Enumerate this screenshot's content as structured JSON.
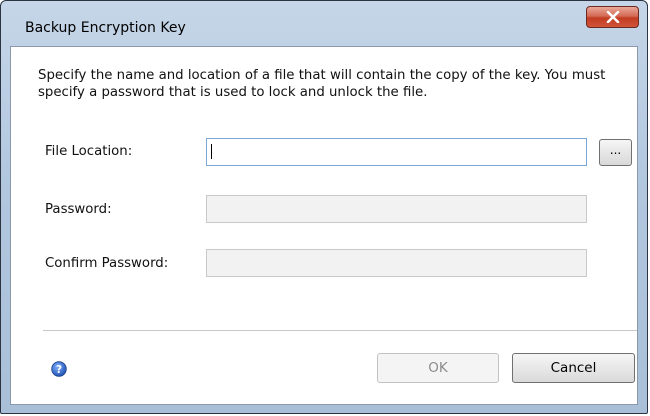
{
  "window": {
    "title": "Backup Encryption Key"
  },
  "description": "Specify the name and location of a file that will contain the copy of the key.  You must specify a password that is used to lock and unlock the file.",
  "form": {
    "file_location": {
      "label": "File Location:",
      "value": ""
    },
    "password": {
      "label": "Password:",
      "value": ""
    },
    "confirm_password": {
      "label": "Confirm Password:",
      "value": ""
    },
    "browse_label": "..."
  },
  "buttons": {
    "ok_label": "OK",
    "cancel_label": "Cancel"
  },
  "icons": {
    "close": "close-icon",
    "help": "help-icon"
  },
  "colors": {
    "titlebar": "#b3c8df",
    "close_button": "#c23c22",
    "help_icon": "#2b63c4",
    "active_field_border": "#7aa7d6"
  }
}
